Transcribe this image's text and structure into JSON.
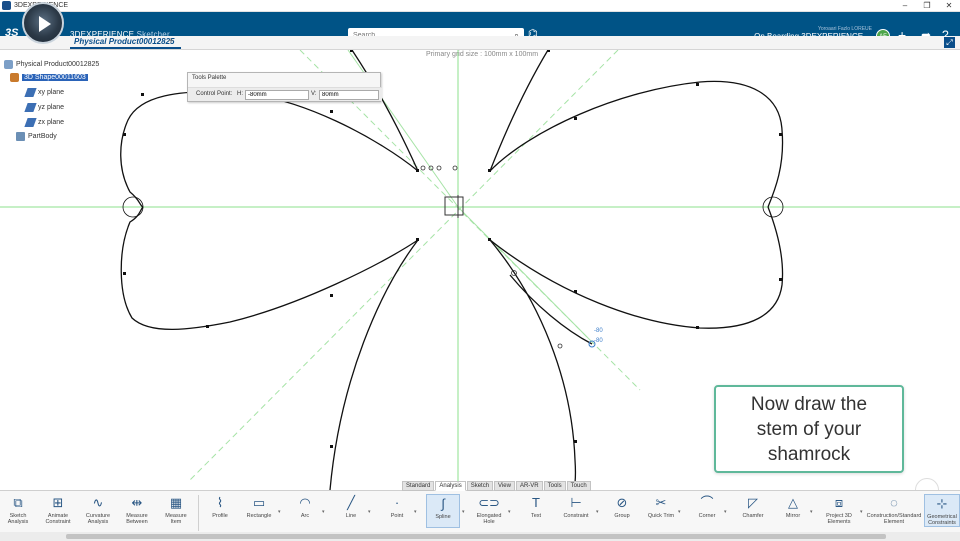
{
  "window": {
    "app_name": "3DEXPERIENCE",
    "controls": [
      "–",
      "❐",
      "✕"
    ]
  },
  "topbar": {
    "brand": "3DEXPERIENCE",
    "brand_app": "Sketcher",
    "search_placeholder": "Search",
    "user_name": "Yoroaari Fazlo LOREUE",
    "space_name": "On Boarding 3DEXPERIENCE",
    "avatar_initials": "AF",
    "ds_logo": "3S"
  },
  "tabbar": {
    "tab_label": "Physical Product00012825",
    "add_tab": "+"
  },
  "canvas": {
    "grid_label": "Primary grid size : 100mm x 100mm",
    "dimension_a": "-80",
    "dimension_b": "-80"
  },
  "tree": {
    "root": "Physical Product00012825",
    "shape": "3D Shape00011603",
    "items": [
      "xy plane",
      "yz plane",
      "zx plane",
      "PartBody"
    ]
  },
  "palette": {
    "title": "Tools Palette",
    "control_point_label": "Control Point:",
    "h_label": "H:",
    "h_value": "-80mm",
    "v_label": "V:",
    "v_value": "80mm"
  },
  "callout": {
    "text": "Now draw the stem of your shamrock"
  },
  "toolbar_tabs": [
    {
      "label": "Standard",
      "active": false
    },
    {
      "label": "Analysis",
      "active": true
    },
    {
      "label": "Sketch",
      "active": false
    },
    {
      "label": "View",
      "active": false
    },
    {
      "label": "AR-VR",
      "active": false
    },
    {
      "label": "Tools",
      "active": false
    },
    {
      "label": "Touch",
      "active": false
    }
  ],
  "actions": {
    "sketch_analysis": "Sketch Analysis",
    "animate_constraint": "Animate Constraint",
    "curvature_analysis": "Curvature Analysis",
    "measure_between": "Measure Between",
    "measure_item": "Measure Item",
    "profile": "Profile",
    "rectangle": "Rectangle",
    "arc": "Arc",
    "line": "Line",
    "point": "Point",
    "spline": "Spline",
    "elongated_hole": "Elongated Hole",
    "text": "Text",
    "constraint": "Constraint",
    "group": "Group",
    "quick_trim": "Quick Trim",
    "corner": "Corner",
    "chamfer": "Chamfer",
    "mirror": "Mirror",
    "project_3d": "Project 3D Elements",
    "construction": "Construction/Standard Element",
    "geometrical": "Geometrical Constraints"
  },
  "colors": {
    "accent": "#005386",
    "grid_green": "#7bd67b",
    "callout_border": "#5fb89a"
  }
}
